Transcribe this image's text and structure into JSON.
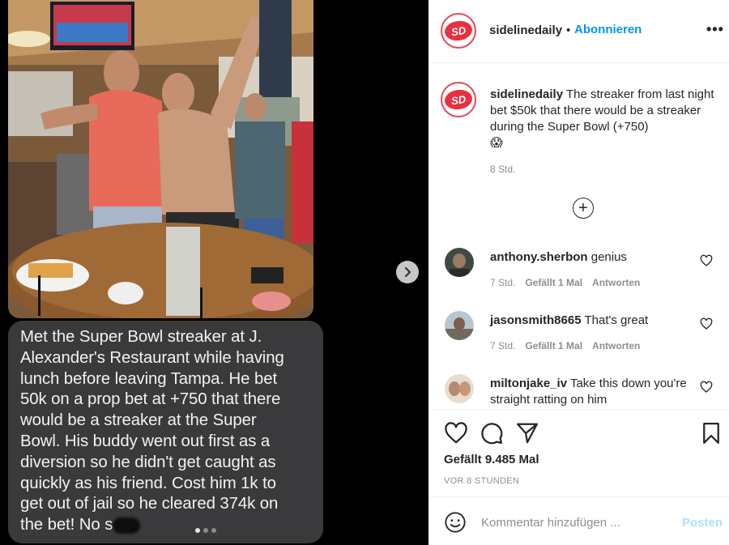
{
  "media": {
    "caption_lines": [
      "Met the Super Bowl streaker at J.",
      "Alexander's Restaurant while having",
      "lunch before leaving Tampa. He bet",
      "50k on a prop bet at +750 that there",
      "would be a streaker at the Super",
      "Bowl. His buddy went out first as a",
      "diversion so he didn't get caught as",
      "quickly as his friend. Cost him 1k to",
      "get out of jail so he cleared 374k on"
    ],
    "caption_last_line": "the bet! No s",
    "carousel": {
      "count": 3,
      "active_index": 0
    },
    "next_icon": "chevron-right-icon"
  },
  "header": {
    "avatar_initials": "SD",
    "username": "sidelinedaily",
    "separator": "•",
    "follow_label": "Abonnieren",
    "more_label": "•••"
  },
  "post": {
    "username": "sidelinedaily",
    "caption": "The streaker from last night bet $50k that there would be a streaker during the Super Bowl (+750)",
    "emoji": "😱",
    "time": "8 Std."
  },
  "load_more_label": "+",
  "comments": [
    {
      "user": "anthony.sherbon",
      "text": "genius",
      "time": "7 Std.",
      "likes": "Gefällt 1 Mal",
      "reply": "Antworten"
    },
    {
      "user": "jasonsmith8665",
      "text": "That's great",
      "time": "7 Std.",
      "likes": "Gefällt 1 Mal",
      "reply": "Antworten"
    },
    {
      "user": "miltonjake_iv",
      "text": "Take this down you're straight ratting on him",
      "time": "",
      "likes": "",
      "reply": ""
    }
  ],
  "actions": {
    "likes_text": "Gefällt 9.485 Mal",
    "time_ago": "VOR 8 STUNDEN"
  },
  "comment_box": {
    "placeholder": "Kommentar hinzufügen ...",
    "post_label": "Posten"
  },
  "colors": {
    "accent_blue": "#0095f6",
    "brand_red": "#e8303f",
    "bubble_gray": "#3a3a3c"
  }
}
